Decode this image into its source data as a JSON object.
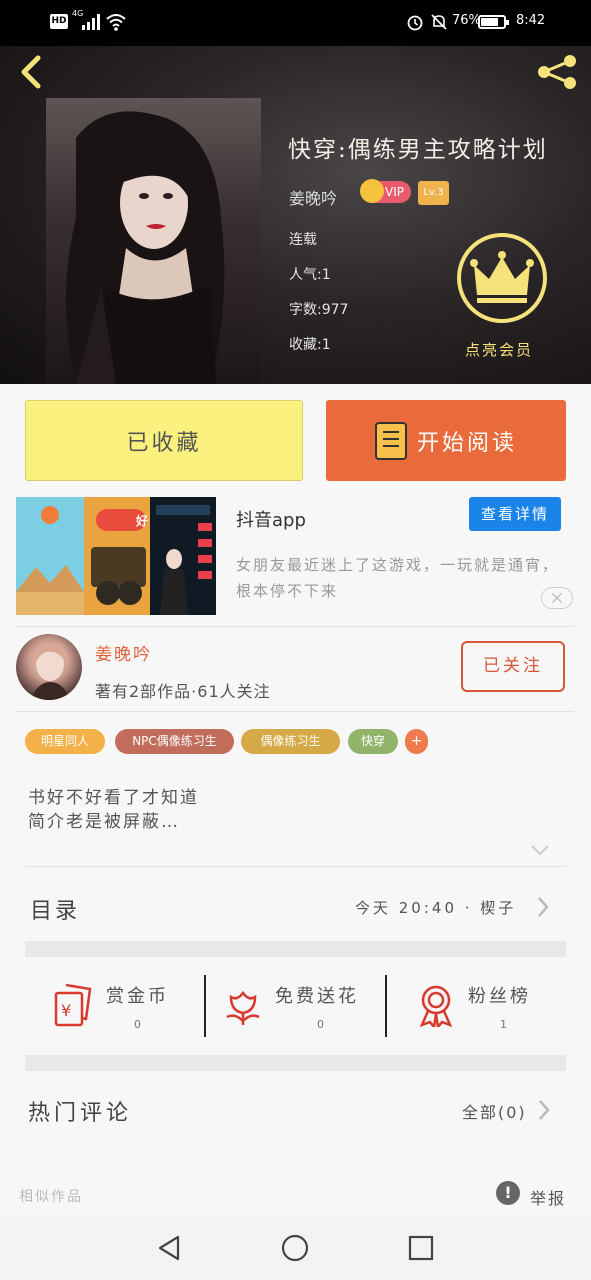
{
  "status_bar": {
    "hd": "HD",
    "network": "4G",
    "battery": "76%",
    "time": "8:42"
  },
  "header": {
    "back_icon": "chevron-left-icon",
    "share_icon": "share-icon",
    "book_title": "快穿:偶练男主攻略计划",
    "author": "姜晚吟",
    "vip_badge": "VIP",
    "level_badge": "Lv.3",
    "status": "连载",
    "popularity": "人气:1",
    "word_count": "字数:977",
    "favorites": "收藏:1",
    "vip_cta": "点亮会员",
    "accent_color": "#f5e27a"
  },
  "actions": {
    "collected_label": "已收藏",
    "read_label": "开始阅读",
    "collected_color": "#fbf17e",
    "read_color": "#e96b3c"
  },
  "ad": {
    "title": "抖音app",
    "detail_button": "查看详情",
    "description": "女朋友最近迷上了这游戏，一玩就是通宵，根本停不下来",
    "image_text": "好",
    "close_icon": "close-icon"
  },
  "author_row": {
    "name": "姜晚吟",
    "stats": "著有2部作品·61人关注",
    "follow_label": "已关注"
  },
  "tags": [
    {
      "label": "明星同人",
      "color": "#f4b14a"
    },
    {
      "label": "NPC偶像练习生",
      "color": "#c26d5b"
    },
    {
      "label": "偶像练习生",
      "color": "#d6a947"
    },
    {
      "label": "快穿",
      "color": "#92b46a"
    },
    {
      "label": "+",
      "color": "#ee7a4e"
    }
  ],
  "synopsis": {
    "line1": "书好不好看了才知道",
    "line2": "简介老是被屏蔽…"
  },
  "catalog": {
    "label": "目录",
    "update": "今天 20:40 · 楔子"
  },
  "rewards": [
    {
      "icon": "red-envelope-icon",
      "label": "赏金币",
      "count": "0"
    },
    {
      "icon": "flower-icon",
      "label": "免费送花",
      "count": "0"
    },
    {
      "icon": "medal-icon",
      "label": "粉丝榜",
      "count": "1"
    }
  ],
  "comments": {
    "label": "热门评论",
    "all_label": "全部(0)"
  },
  "footer": {
    "similar_label": "相似作品",
    "report_label": "举报"
  },
  "nav_bar": {
    "back": "nav-back-icon",
    "home": "nav-home-icon",
    "recents": "nav-recents-icon"
  }
}
